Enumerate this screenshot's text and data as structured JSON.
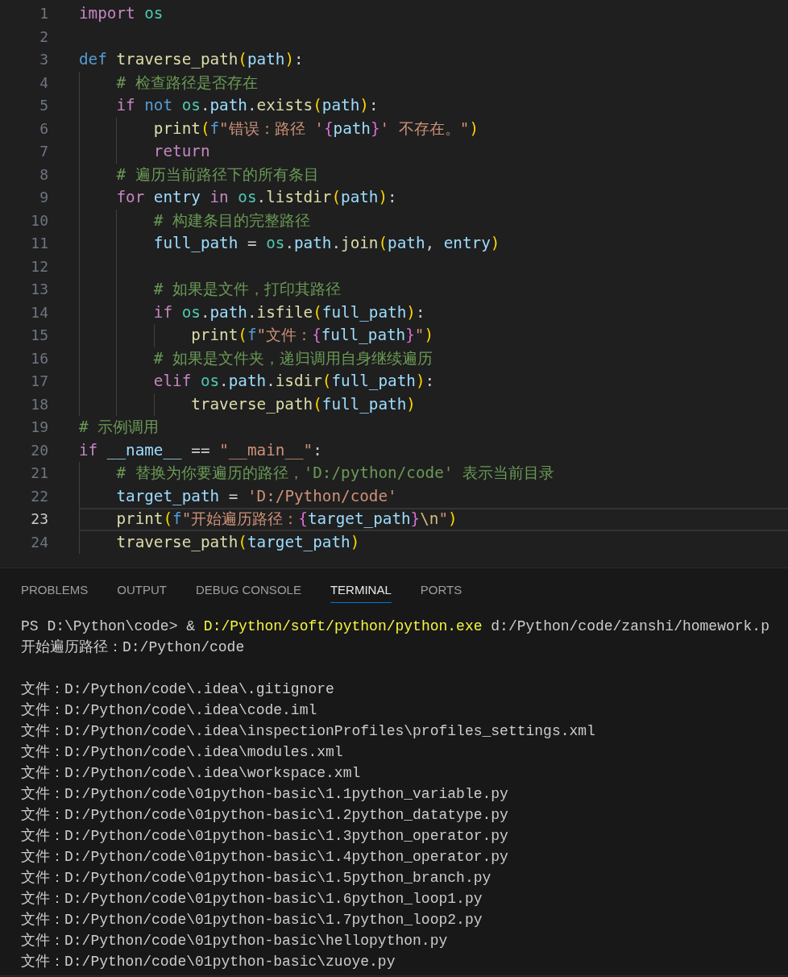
{
  "code_lines": [
    {
      "number": "1",
      "current": false,
      "tokens": [
        {
          "text": "import",
          "kind": "control"
        },
        {
          "text": " os",
          "kind": "module"
        }
      ]
    },
    {
      "number": "2",
      "current": false
    },
    {
      "number": "3",
      "current": false,
      "tokens": [
        {
          "text": "def",
          "kind": "keyword"
        },
        {
          "text": " traverse_path",
          "kind": "func"
        },
        {
          "text": "(",
          "kind": "paren"
        },
        {
          "text": "path",
          "kind": "var"
        },
        {
          "text": ")",
          "kind": "paren"
        },
        {
          "text": ":",
          "kind": "plain"
        }
      ],
      "children": [
        {
          "number": "4",
          "current": false,
          "tokens": [
            {
              "text": "# 检查路径是否存在",
              "kind": "comment"
            }
          ]
        },
        {
          "number": "5",
          "current": false,
          "tokens": [
            {
              "text": "if",
              "kind": "control"
            },
            {
              "text": " not",
              "kind": "keyword"
            },
            {
              "text": " os",
              "kind": "module"
            },
            {
              "text": ".",
              "kind": "plain"
            },
            {
              "text": "path",
              "kind": "var"
            },
            {
              "text": ".",
              "kind": "plain"
            },
            {
              "text": "exists",
              "kind": "func"
            },
            {
              "text": "(",
              "kind": "paren"
            },
            {
              "text": "path",
              "kind": "var"
            },
            {
              "text": ")",
              "kind": "paren"
            },
            {
              "text": ":",
              "kind": "plain"
            }
          ],
          "children": [
            {
              "number": "6",
              "current": false,
              "tokens": [
                {
                  "text": "print",
                  "kind": "func"
                },
                {
                  "text": "(",
                  "kind": "paren"
                },
                {
                  "text": "f",
                  "kind": "keyword"
                },
                {
                  "text": "\"错误：路径 '",
                  "kind": "string"
                },
                {
                  "text": "{",
                  "kind": "brace"
                },
                {
                  "text": "path",
                  "kind": "var"
                },
                {
                  "text": "}",
                  "kind": "brace"
                },
                {
                  "text": "' 不存在。\"",
                  "kind": "string"
                },
                {
                  "text": ")",
                  "kind": "paren"
                }
              ]
            },
            {
              "number": "7",
              "current": false,
              "tokens": [
                {
                  "text": "return",
                  "kind": "control"
                }
              ]
            }
          ]
        },
        {
          "number": "8",
          "current": false,
          "tokens": [
            {
              "text": "# 遍历当前路径下的所有条目",
              "kind": "comment"
            }
          ]
        },
        {
          "number": "9",
          "current": false,
          "tokens": [
            {
              "text": "for",
              "kind": "control"
            },
            {
              "text": " entry",
              "kind": "var"
            },
            {
              "text": " in",
              "kind": "control"
            },
            {
              "text": " os",
              "kind": "module"
            },
            {
              "text": ".",
              "kind": "plain"
            },
            {
              "text": "listdir",
              "kind": "func"
            },
            {
              "text": "(",
              "kind": "paren"
            },
            {
              "text": "path",
              "kind": "var"
            },
            {
              "text": ")",
              "kind": "paren"
            },
            {
              "text": ":",
              "kind": "plain"
            }
          ],
          "children": [
            {
              "number": "10",
              "current": false,
              "tokens": [
                {
                  "text": "# 构建条目的完整路径",
                  "kind": "comment"
                }
              ]
            },
            {
              "number": "11",
              "current": false,
              "tokens": [
                {
                  "text": "full_path",
                  "kind": "var"
                },
                {
                  "text": " = ",
                  "kind": "plain"
                },
                {
                  "text": "os",
                  "kind": "module"
                },
                {
                  "text": ".",
                  "kind": "plain"
                },
                {
                  "text": "path",
                  "kind": "var"
                },
                {
                  "text": ".",
                  "kind": "plain"
                },
                {
                  "text": "join",
                  "kind": "func"
                },
                {
                  "text": "(",
                  "kind": "paren"
                },
                {
                  "text": "path",
                  "kind": "var"
                },
                {
                  "text": ",",
                  "kind": "plain"
                },
                {
                  "text": " entry",
                  "kind": "var"
                },
                {
                  "text": ")",
                  "kind": "paren"
                }
              ]
            },
            {
              "number": "12",
              "current": false
            },
            {
              "number": "13",
              "current": false,
              "tokens": [
                {
                  "text": "# 如果是文件，打印其路径",
                  "kind": "comment"
                }
              ]
            },
            {
              "number": "14",
              "current": false,
              "tokens": [
                {
                  "text": "if",
                  "kind": "control"
                },
                {
                  "text": " os",
                  "kind": "module"
                },
                {
                  "text": ".",
                  "kind": "plain"
                },
                {
                  "text": "path",
                  "kind": "var"
                },
                {
                  "text": ".",
                  "kind": "plain"
                },
                {
                  "text": "isfile",
                  "kind": "func"
                },
                {
                  "text": "(",
                  "kind": "paren"
                },
                {
                  "text": "full_path",
                  "kind": "var"
                },
                {
                  "text": ")",
                  "kind": "paren"
                },
                {
                  "text": ":",
                  "kind": "plain"
                }
              ],
              "children": [
                {
                  "number": "15",
                  "current": false,
                  "tokens": [
                    {
                      "text": "print",
                      "kind": "func"
                    },
                    {
                      "text": "(",
                      "kind": "paren"
                    },
                    {
                      "text": "f",
                      "kind": "keyword"
                    },
                    {
                      "text": "\"文件：",
                      "kind": "string"
                    },
                    {
                      "text": "{",
                      "kind": "brace"
                    },
                    {
                      "text": "full_path",
                      "kind": "var"
                    },
                    {
                      "text": "}",
                      "kind": "brace"
                    },
                    {
                      "text": "\"",
                      "kind": "string"
                    },
                    {
                      "text": ")",
                      "kind": "paren"
                    }
                  ]
                }
              ]
            },
            {
              "number": "16",
              "current": false,
              "tokens": [
                {
                  "text": "# 如果是文件夹，递归调用自身继续遍历",
                  "kind": "comment"
                }
              ]
            },
            {
              "number": "17",
              "current": false,
              "tokens": [
                {
                  "text": "elif",
                  "kind": "control"
                },
                {
                  "text": " os",
                  "kind": "module"
                },
                {
                  "text": ".",
                  "kind": "plain"
                },
                {
                  "text": "path",
                  "kind": "var"
                },
                {
                  "text": ".",
                  "kind": "plain"
                },
                {
                  "text": "isdir",
                  "kind": "func"
                },
                {
                  "text": "(",
                  "kind": "paren"
                },
                {
                  "text": "full_path",
                  "kind": "var"
                },
                {
                  "text": ")",
                  "kind": "paren"
                },
                {
                  "text": ":",
                  "kind": "plain"
                }
              ],
              "children": [
                {
                  "number": "18",
                  "current": false,
                  "tokens": [
                    {
                      "text": "traverse_path",
                      "kind": "func"
                    },
                    {
                      "text": "(",
                      "kind": "paren"
                    },
                    {
                      "text": "full_path",
                      "kind": "var"
                    },
                    {
                      "text": ")",
                      "kind": "paren"
                    }
                  ]
                }
              ]
            }
          ]
        }
      ]
    },
    {
      "number": "19",
      "current": false,
      "tokens": [
        {
          "text": "# 示例调用",
          "kind": "comment"
        }
      ]
    },
    {
      "number": "20",
      "current": false,
      "tokens": [
        {
          "text": "if",
          "kind": "control"
        },
        {
          "text": " __name__",
          "kind": "var"
        },
        {
          "text": " == ",
          "kind": "plain"
        },
        {
          "text": "\"__main__\"",
          "kind": "string"
        },
        {
          "text": ":",
          "kind": "plain"
        }
      ],
      "children": [
        {
          "number": "21",
          "current": false,
          "tokens": [
            {
              "text": "# 替换为你要遍历的路径，'D:/python/code' 表示当前目录",
              "kind": "comment"
            }
          ]
        },
        {
          "number": "22",
          "current": false,
          "tokens": [
            {
              "text": "target_path",
              "kind": "var"
            },
            {
              "text": " = ",
              "kind": "plain"
            },
            {
              "text": "'D:/Python/code'",
              "kind": "string"
            }
          ]
        },
        {
          "number": "23",
          "current": true,
          "tokens": [
            {
              "text": "print",
              "kind": "func"
            },
            {
              "text": "(",
              "kind": "paren"
            },
            {
              "text": "f",
              "kind": "keyword"
            },
            {
              "text": "\"开始遍历路径：",
              "kind": "string"
            },
            {
              "text": "{",
              "kind": "brace"
            },
            {
              "text": "target_path",
              "kind": "var"
            },
            {
              "text": "}",
              "kind": "brace"
            },
            {
              "text": "\\n",
              "kind": "escape"
            },
            {
              "text": "\"",
              "kind": "string"
            },
            {
              "text": ")",
              "kind": "paren"
            }
          ]
        },
        {
          "number": "24",
          "current": false,
          "tokens": [
            {
              "text": "traverse_path",
              "kind": "func"
            },
            {
              "text": "(",
              "kind": "paren"
            },
            {
              "text": "target_path",
              "kind": "var"
            },
            {
              "text": ")",
              "kind": "paren"
            }
          ]
        }
      ]
    }
  ],
  "panel_tabs": [
    {
      "label": "PROBLEMS",
      "selected": false
    },
    {
      "label": "OUTPUT",
      "selected": false
    },
    {
      "label": "DEBUG CONSOLE",
      "selected": false
    },
    {
      "label": "TERMINAL",
      "selected": true
    },
    {
      "label": "PORTS",
      "selected": false
    }
  ],
  "terminal_lines": [
    {
      "kind": "command",
      "segments": [
        {
          "text": "PS D:\\Python\\code> &",
          "kind": "plain"
        },
        {
          "text": " D:/Python/soft/python/python.exe",
          "kind": "exe"
        },
        {
          "text": " d:/Python/code/zanshi/homework.p",
          "kind": "plain"
        }
      ]
    },
    {
      "kind": "output",
      "text": "开始遍历路径：D:/Python/code"
    },
    {
      "kind": "blank"
    },
    {
      "kind": "output",
      "text": "文件：D:/Python/code\\.idea\\.gitignore"
    },
    {
      "kind": "output",
      "text": "文件：D:/Python/code\\.idea\\code.iml"
    },
    {
      "kind": "output",
      "text": "文件：D:/Python/code\\.idea\\inspectionProfiles\\profiles_settings.xml"
    },
    {
      "kind": "output",
      "text": "文件：D:/Python/code\\.idea\\modules.xml"
    },
    {
      "kind": "output",
      "text": "文件：D:/Python/code\\.idea\\workspace.xml"
    },
    {
      "kind": "output",
      "text": "文件：D:/Python/code\\01python-basic\\1.1python_variable.py"
    },
    {
      "kind": "output",
      "text": "文件：D:/Python/code\\01python-basic\\1.2python_datatype.py"
    },
    {
      "kind": "output",
      "text": "文件：D:/Python/code\\01python-basic\\1.3python_operator.py"
    },
    {
      "kind": "output",
      "text": "文件：D:/Python/code\\01python-basic\\1.4python_operator.py"
    },
    {
      "kind": "output",
      "text": "文件：D:/Python/code\\01python-basic\\1.5python_branch.py"
    },
    {
      "kind": "output",
      "text": "文件：D:/Python/code\\01python-basic\\1.6python_loop1.py"
    },
    {
      "kind": "output",
      "text": "文件：D:/Python/code\\01python-basic\\1.7python_loop2.py"
    },
    {
      "kind": "output",
      "text": "文件：D:/Python/code\\01python-basic\\hellopython.py"
    },
    {
      "kind": "output",
      "text": "文件：D:/Python/code\\01python-basic\\zuoye.py"
    }
  ]
}
